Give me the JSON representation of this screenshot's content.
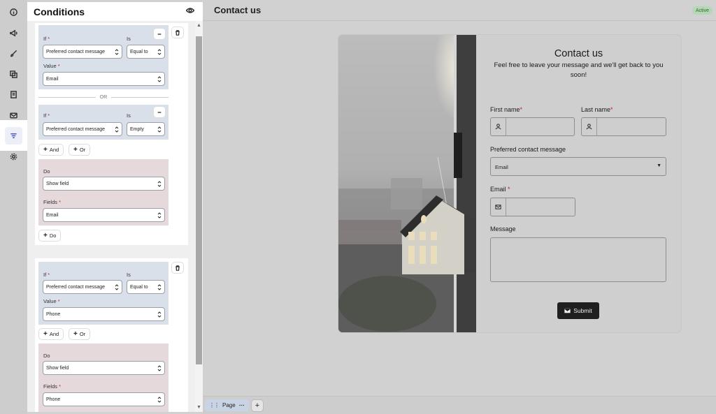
{
  "sidebar": {
    "items": [
      {
        "icon": "info-icon"
      },
      {
        "icon": "megaphone-icon"
      },
      {
        "icon": "brush-icon"
      },
      {
        "icon": "layers-icon"
      },
      {
        "icon": "form-icon"
      },
      {
        "icon": "mail-icon"
      },
      {
        "icon": "filter-icon",
        "active": true
      },
      {
        "icon": "gear-icon"
      }
    ]
  },
  "conditions": {
    "title": "Conditions",
    "groups": [
      {
        "if_rows": [
          {
            "if_label": "If",
            "is_label": "Is",
            "field": "Preferred contact message",
            "operator": "Equal to",
            "value_label": "Value",
            "value": "Email"
          },
          {
            "if_label": "If",
            "is_label": "Is",
            "field": "Preferred contact message",
            "operator": "Empty"
          }
        ],
        "or_label": "OR",
        "and_button": "And",
        "or_button": "Or",
        "do_label": "Do",
        "action": "Show field",
        "fields_label": "Fields",
        "fields_value": "Email",
        "do_button": "Do"
      },
      {
        "if_rows": [
          {
            "if_label": "If",
            "is_label": "Is",
            "field": "Preferred contact message",
            "operator": "Equal to",
            "value_label": "Value",
            "value": "Phone"
          }
        ],
        "and_button": "And",
        "or_button": "Or",
        "do_label": "Do",
        "action": "Show field",
        "fields_label": "Fields",
        "fields_value": "Phone"
      }
    ]
  },
  "header": {
    "title": "Contact us",
    "status": "Active"
  },
  "form": {
    "title": "Contact us",
    "subtitle": "Feel free to leave your message and we'll get back to you soon!",
    "first_name_label": "First name",
    "last_name_label": "Last name",
    "preferred_label": "Preferred contact message",
    "preferred_value": "Email",
    "email_label": "Email",
    "message_label": "Message",
    "submit_label": "Submit"
  },
  "footer": {
    "page_tab": "Page",
    "add": "+"
  },
  "colors": {
    "accent": "#4a54c6",
    "if_block": "#d9e0ea",
    "do_block": "#e5d9dc",
    "status_bg": "#b6d7b6"
  }
}
